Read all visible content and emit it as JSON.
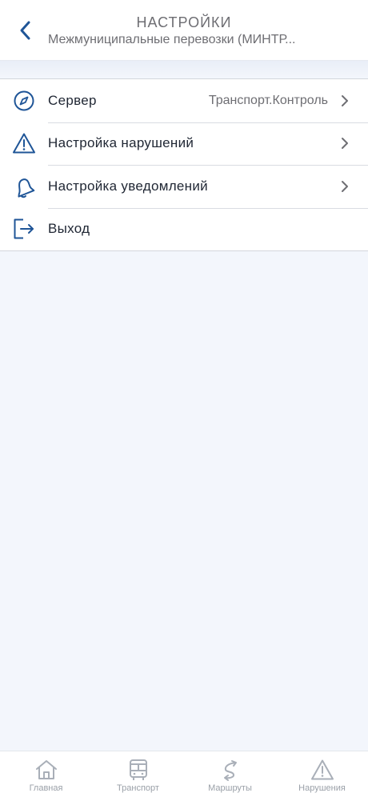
{
  "header": {
    "title": "НАСТРОЙКИ",
    "subtitle": "Межмуниципальные перевозки (МИНТР..."
  },
  "menu": {
    "items": [
      {
        "label": "Сервер",
        "value": "Транспорт.Контроль",
        "icon": "compass-icon"
      },
      {
        "label": "Настройка нарушений",
        "icon": "warning-icon"
      },
      {
        "label": "Настройка уведомлений",
        "icon": "bell-icon"
      },
      {
        "label": "Выход",
        "icon": "logout-icon"
      }
    ]
  },
  "tabbar": {
    "tabs": [
      {
        "label": "Главная",
        "icon": "home-icon"
      },
      {
        "label": "Транспорт",
        "icon": "bus-icon"
      },
      {
        "label": "Маршруты",
        "icon": "route-icon"
      },
      {
        "label": "Нарушения",
        "icon": "warning-icon"
      }
    ]
  },
  "colors": {
    "accent": "#1f5597",
    "icon_gray": "#a9afb8",
    "background": "#f3f6fc"
  }
}
